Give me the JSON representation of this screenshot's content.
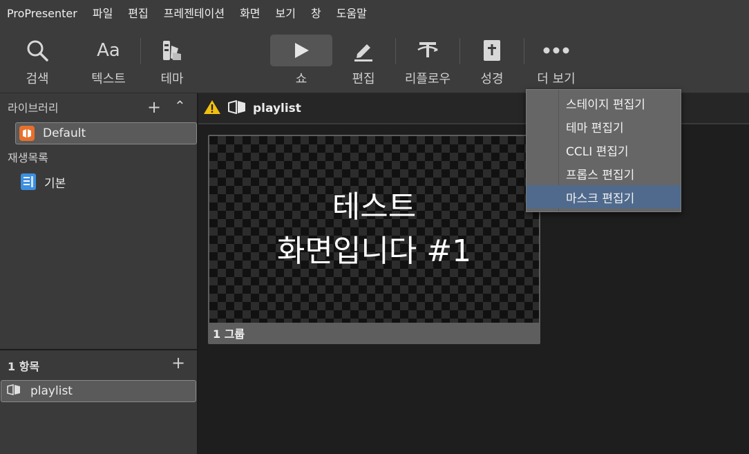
{
  "menubar": {
    "items": [
      "ProPresenter",
      "파일",
      "편집",
      "프레젠테이션",
      "화면",
      "보기",
      "창",
      "도움말"
    ]
  },
  "toolbar": {
    "buttons": [
      {
        "label": "검색",
        "icon": "search-icon"
      },
      {
        "label": "텍스트",
        "icon": "text-aa-icon"
      },
      {
        "label": "테마",
        "icon": "theme-icon"
      },
      {
        "label": "쇼",
        "icon": "play-icon",
        "active": true
      },
      {
        "label": "편집",
        "icon": "pencil-icon"
      },
      {
        "label": "리플로우",
        "icon": "reflow-icon"
      },
      {
        "label": "성경",
        "icon": "bible-icon"
      },
      {
        "label": "더 보기",
        "icon": "more-icon"
      }
    ]
  },
  "sidebar": {
    "library_title": "라이브러리",
    "library_item": "Default",
    "playlists_title": "재생목록",
    "playlist_item": "기본",
    "lower_title": "1 항목",
    "lower_item": "playlist"
  },
  "main": {
    "header_title": "playlist",
    "slide": {
      "line1": "테스트",
      "line2": "화면입니다 #1",
      "footer": "1 그룹"
    }
  },
  "dropdown": {
    "items": [
      "스테이지 편집기",
      "테마 편집기",
      "CCLI 편집기",
      "프롭스 편집기",
      "마스크 편집기"
    ],
    "highlighted_index": 4
  },
  "colors": {
    "toolbar_bg": "#3c3c3c",
    "highlight": "#4f6a8c",
    "warning": "#f2c10f",
    "library_icon": "#e8702a",
    "playlist_icon": "#3d8fe0"
  }
}
